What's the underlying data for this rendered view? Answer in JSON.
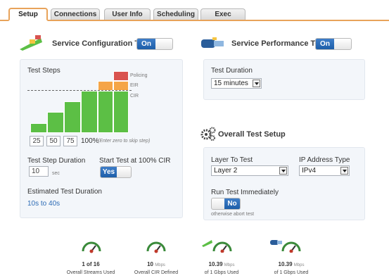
{
  "tabs": [
    {
      "label": "Setup",
      "active": true
    },
    {
      "label": "Connections",
      "active": false
    },
    {
      "label": "User Info",
      "active": false
    },
    {
      "label": "Scheduling",
      "active": false
    },
    {
      "label": "Exec Options",
      "active": false
    }
  ],
  "config": {
    "title": "Service Configuration Test",
    "toggle": "On",
    "test_steps_label": "Test Steps",
    "legend": {
      "policing": "Policing",
      "eir": "EIR",
      "cir": "CIR"
    },
    "steps": [
      "25",
      "50",
      "75"
    ],
    "step_full": "100%",
    "step_hint": "(Enter zero to skip step)",
    "step_duration_label": "Test Step Duration",
    "step_duration_value": "10",
    "step_duration_unit": "sec",
    "start_label": "Start Test at 100% CIR",
    "start_toggle": "Yes",
    "estimated_label": "Estimated Test Duration",
    "estimated_value": "10s to 40s"
  },
  "performance": {
    "title": "Service Performance Test",
    "toggle": "On",
    "duration_label": "Test Duration",
    "duration_value": "15 minutes"
  },
  "overall": {
    "title": "Overall Test Setup",
    "layer_label": "Layer To Test",
    "layer_value": "Layer 2",
    "ip_label": "IP Address Type",
    "ip_value": "IPv4",
    "run_label": "Run Test Immediately",
    "run_toggle": "No",
    "run_note": "otherwise abort test"
  },
  "gauges": [
    {
      "value": "1 of 16",
      "unit": "",
      "label": "Overall Streams Used",
      "icon": "gauge-icon"
    },
    {
      "value": "10",
      "unit": "Mbps",
      "label": "Overall CIR Defined",
      "icon": "gauge-icon"
    },
    {
      "value": "10.39",
      "unit": "Mbps",
      "label": "of 1 Gbps Used",
      "icon": "gauge-config-icon"
    },
    {
      "value": "10.39",
      "unit": "Mbps",
      "label": "of 1 Gbps Used",
      "icon": "gauge-performance-icon"
    }
  ],
  "colors": {
    "accent_orange": "#e8a35a",
    "toggle_blue": "#1d5ea8",
    "bar_green": "#5cbf45",
    "eir_orange": "#f5a547",
    "policing_red": "#d9534f"
  }
}
